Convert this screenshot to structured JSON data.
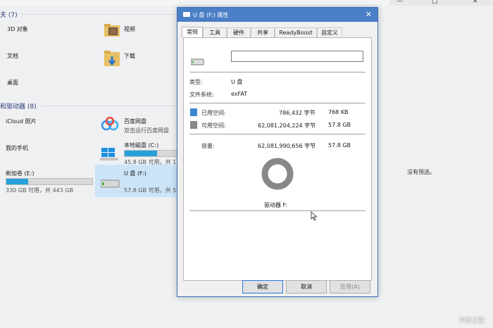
{
  "explorer": {
    "header_top_partial": "夫 (7)",
    "folders": [
      {
        "label": "3D 对象"
      },
      {
        "label": "视频"
      },
      {
        "label": "文档"
      },
      {
        "label": "下载"
      },
      {
        "label": "桌面"
      }
    ],
    "devices_header": "和驱动器 (8)",
    "devices": {
      "icloud": "iCloud 照片",
      "phone": "我的手机",
      "baidu_title": "百度网盘",
      "baidu_sub": "双击运行百度网盘",
      "local_disk_title": "本地磁盘 (C:)",
      "local_disk_info": "45.8 GB 可用，共 11",
      "new_volume_title": "新加卷 (E:)",
      "new_volume_info": "330 GB 可用，共 443 GB",
      "new_volume_used_fraction": 0.255,
      "local_disk_used_fraction": 0.62,
      "usb_title": "U 盘 (F:)",
      "usb_info": "57.8 GB 可用，共 57"
    },
    "preview_text": "没有预选。",
    "top_controls": [
      "—",
      "□",
      "✕"
    ]
  },
  "dialog": {
    "title": "U 盘 (F:) 属性",
    "close": "✕",
    "tabs": [
      "常规",
      "工具",
      "硬件",
      "共享",
      "ReadyBoost",
      "自定义"
    ],
    "name_value": "",
    "type_label": "类型:",
    "type_value": "U 盘",
    "fs_label": "文件系统:",
    "fs_value": "exFAT",
    "used_label": "已用空间:",
    "used_bytes": "786,432 字节",
    "used_size": "768 KB",
    "free_label": "可用空间:",
    "free_bytes": "62,081,204,224 字节",
    "free_size": "57.8 GB",
    "capacity_label": "容量:",
    "capacity_bytes": "62,081,990,656 字节",
    "capacity_size": "57.8 GB",
    "drive_label": "驱动器 F:",
    "used_fraction": 1.27e-05,
    "colors": {
      "used": "#3d86d0",
      "free": "#888888"
    },
    "buttons": {
      "ok": "确定",
      "cancel": "取消",
      "apply": "应用(A)"
    }
  },
  "watermark": "汽车之家"
}
